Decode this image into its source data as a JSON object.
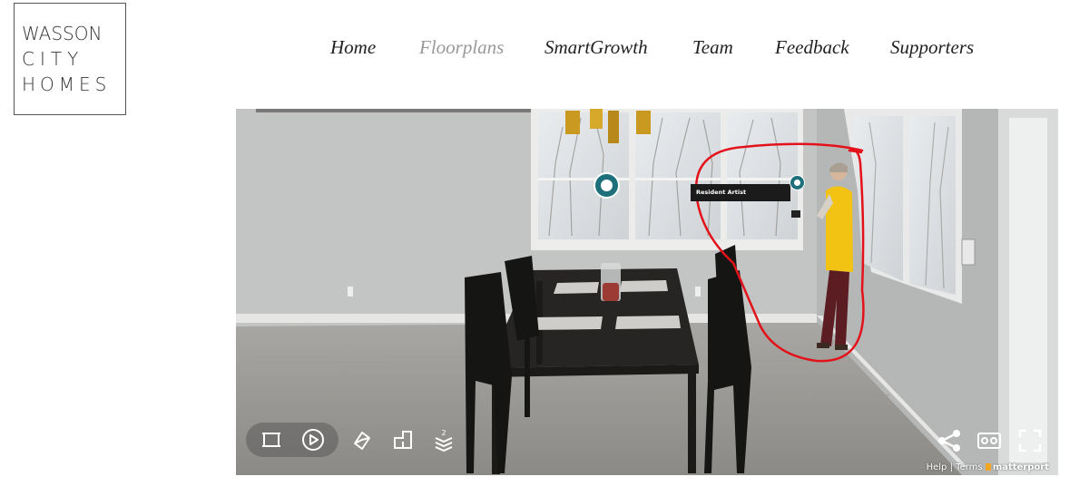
{
  "logo": {
    "line1": "WASSON",
    "line2": "CITY",
    "line3": "HOMES"
  },
  "nav": {
    "items": [
      {
        "label": "Home",
        "active": false
      },
      {
        "label": "Floorplans",
        "active": true
      },
      {
        "label": "SmartGrowth",
        "active": false
      },
      {
        "label": "Team",
        "active": false
      },
      {
        "label": "Feedback",
        "active": false
      },
      {
        "label": "Supporters",
        "active": false
      }
    ]
  },
  "viewer": {
    "tag_label": "Resident Artist",
    "controls": [
      "dollhouse-icon",
      "play-icon",
      "measure-icon",
      "floorplan-icon",
      "floors-icon",
      "share-icon",
      "vr-icon",
      "fullscreen-icon"
    ],
    "floors_badge": "2",
    "footer": {
      "help": "Help",
      "separator": "|",
      "terms": "Terms",
      "brand": "matterport"
    },
    "colors": {
      "pin": "#1d6f7a",
      "annotation": "#e3121a",
      "active_nav": "#999999"
    }
  }
}
